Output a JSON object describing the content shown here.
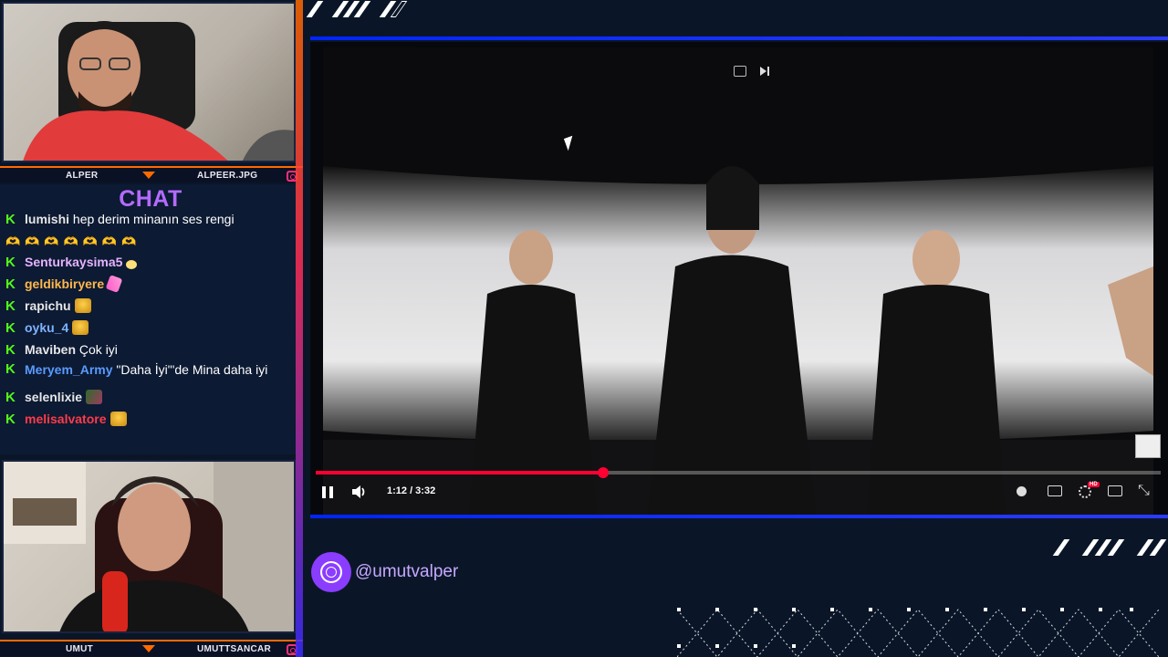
{
  "streamers": {
    "top": {
      "left_name": "ALPER",
      "right_name": "ALPEER.JPG"
    },
    "bottom": {
      "left_name": "UMUT",
      "right_name": "UMUTTSANCAR"
    }
  },
  "chat": {
    "title": "CHAT",
    "messages": [
      {
        "user": "lumishi",
        "color": "#e6e6e6",
        "text": "hep derim minanın ses rengi"
      },
      {
        "user": "",
        "color": "#e6e6e6",
        "text": "🫶🫶🫶🫶🫶🫶🫶"
      },
      {
        "user": "Senturkaysima5",
        "color": "#e6b3ff",
        "text": ""
      },
      {
        "user": "geldikbiryere",
        "color": "#ffb84d",
        "text": ""
      },
      {
        "user": "rapichu",
        "color": "#e6e6e6",
        "text": ""
      },
      {
        "user": "oyku_4",
        "color": "#7fb2ff",
        "text": ""
      },
      {
        "user": "Maviben",
        "color": "#e6e6e6",
        "text": "Çok iyi"
      },
      {
        "user": "Meryem_Army",
        "color": "#5a9bff",
        "text": "\"Daha İyi\"'de Mina daha iyi"
      },
      {
        "user": "selenlixie",
        "color": "#e6e6e6",
        "text": ""
      },
      {
        "user": "melisalvatore",
        "color": "#ff3b4a",
        "text": ""
      }
    ]
  },
  "video": {
    "time": "1:12 / 3:32",
    "progress": 0.34
  },
  "social": {
    "handle": "@umutvalper"
  },
  "colors": {
    "accent": "#b46bff",
    "progress": "#ff0033",
    "kick": "#53fc18"
  }
}
